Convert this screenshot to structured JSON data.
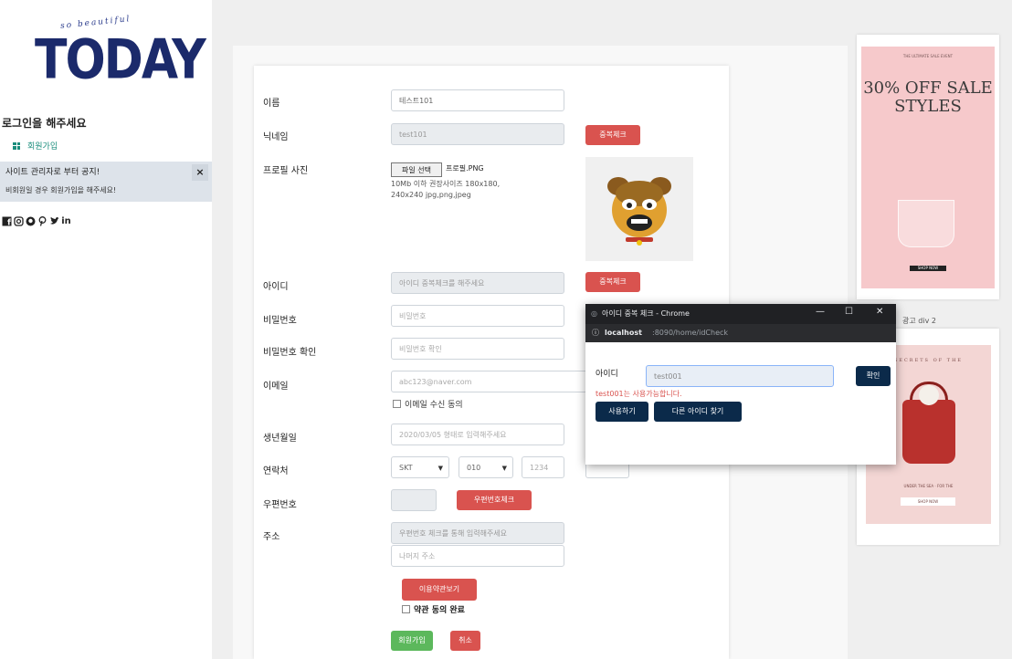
{
  "sidebar": {
    "logo_script": "so beautiful",
    "logo_text": "TODAY",
    "login_prompt": "로그인을 해주세요",
    "signup_link": "회원가입",
    "notice_title": "사이트 관리자로 부터 공지!",
    "notice_body": "비회원일 경우 회원가입을 해주세요!",
    "notice_close": "×",
    "socials": [
      "facebook-icon",
      "instagram-icon",
      "github-icon",
      "pinterest-icon",
      "twitter-icon",
      "linkedin-icon"
    ]
  },
  "form": {
    "name_label": "이름",
    "name_value": "테스트101",
    "nickname_label": "닉네임",
    "nickname_value": "test101",
    "nickname_check": "중복체크",
    "photo_label": "프로필 사진",
    "file_button": "파일 선택",
    "file_none": "프로필.PNG",
    "file_note": "10Mb 이하  권장사이즈 180x180, 240x240 jpg,png,jpeg",
    "id_label": "아이디",
    "id_placeholder": "아이디 중복체크를 해주세요",
    "id_check": "중복체크",
    "pw_label": "비밀번호",
    "pw_placeholder": "비밀번호",
    "pw_confirm_label": "비밀번호 확인",
    "pw_confirm_placeholder": "비밀번호 확인",
    "email_label": "이메일",
    "email_placeholder": "abc123@naver.com",
    "email_consent": "이메일 수신 동의",
    "birth_label": "생년월일",
    "birth_placeholder": "2020/03/05 형태로 입력해주세요",
    "phone_label": "연락처",
    "carrier": "SKT",
    "phone_prefix": "010",
    "phone_mid": "1234",
    "zip_label": "우편번호",
    "zip_check": "우편번호체크",
    "addr_label": "주소",
    "addr_placeholder": "우편번호 체크를 통해 입력해주세요",
    "addr_detail_placeholder": "나머지 주소",
    "terms_button": "이용약관보기",
    "terms_agree": "약관 동의 완료",
    "submit": "회원가입",
    "cancel": "취소"
  },
  "ads": {
    "ad1_top": "THE ULTIMATE SALE EVENT",
    "ad1_headline": "30% OFF SALE STYLES",
    "ad1_cta": "SHOP NOW",
    "ad_label": "광고 div 2",
    "ad2_arc": "SECRETS OF THE",
    "ad2_caption": "UNDER THE SEA · FOR THE",
    "ad2_button": "SHOP NOW"
  },
  "popup": {
    "title": "아이디 중복 체크 - Chrome",
    "url_host": "localhost",
    "url_path": ":8090/home/idCheck",
    "id_label": "아이디",
    "id_value": "test001",
    "confirm": "확인",
    "message": "test001는 사용가능합니다.",
    "use_button": "사용하기",
    "other_button": "다른 아이디 찾기"
  },
  "colors": {
    "accent_red": "#d9534f",
    "accent_green": "#5cb85c",
    "popup_button": "#0b2a4a",
    "logo_navy": "#1b2a6b"
  }
}
